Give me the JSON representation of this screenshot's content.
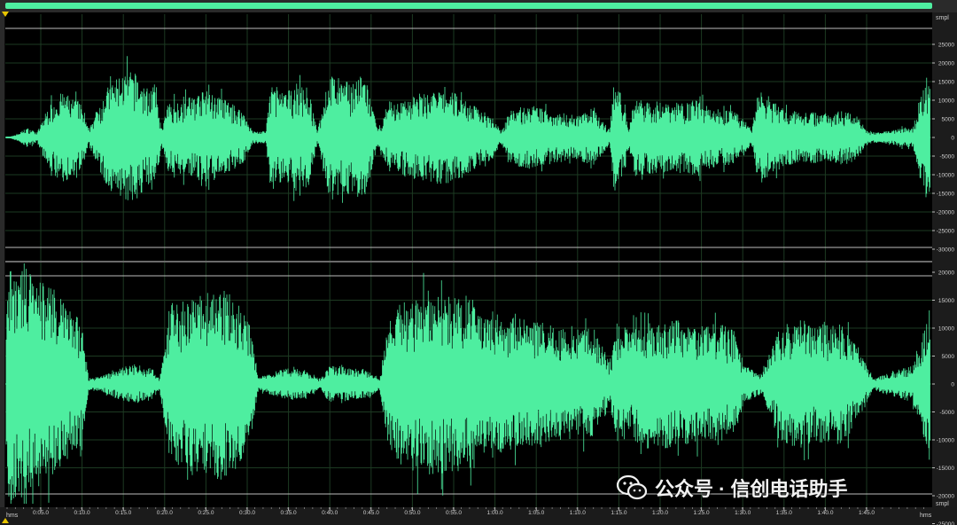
{
  "colors": {
    "waveform": "#4eeea0",
    "background": "#000000",
    "grid": "#1d3a22",
    "range_bar": "#4eeea0",
    "marker": "#e7c400"
  },
  "ruler": {
    "unit_top": "smpl",
    "unit_bottom": "smpl",
    "ch1_ticks": [
      {
        "label": "25000",
        "v": 25000
      },
      {
        "label": "20000",
        "v": 20000
      },
      {
        "label": "15000",
        "v": 15000
      },
      {
        "label": "10000",
        "v": 10000
      },
      {
        "label": "5000",
        "v": 5000
      },
      {
        "label": "0",
        "v": 0
      },
      {
        "label": "-5000",
        "v": -5000
      },
      {
        "label": "-10000",
        "v": -10000
      },
      {
        "label": "-15000",
        "v": -15000
      },
      {
        "label": "-20000",
        "v": -20000
      },
      {
        "label": "-25000",
        "v": -25000
      },
      {
        "label": "-30000",
        "v": -30000
      }
    ],
    "ch2_ticks": [
      {
        "label": "20000",
        "v": 20000
      },
      {
        "label": "15000",
        "v": 15000
      },
      {
        "label": "10000",
        "v": 10000
      },
      {
        "label": "5000",
        "v": 5000
      },
      {
        "label": "0",
        "v": 0
      },
      {
        "label": "-5000",
        "v": -5000
      },
      {
        "label": "-10000",
        "v": -10000
      },
      {
        "label": "-15000",
        "v": -15000
      },
      {
        "label": "-20000",
        "v": -20000
      },
      {
        "label": "-25000",
        "v": -25000
      }
    ]
  },
  "timeline": {
    "unit_left": "hms",
    "unit_right": "hms",
    "labels": [
      "0:05.0",
      "0:10.0",
      "0:15.0",
      "0:20.0",
      "0:25.0",
      "0:30.0",
      "0:35.0",
      "0:40.0",
      "0:45.0",
      "0:50.0",
      "0:55.0",
      "1:00.0",
      "1:05.0",
      "1:10.0",
      "1:15.0",
      "1:20.0",
      "1:25.0",
      "1:30.0",
      "1:35.0",
      "1:40.0",
      "1:45.0"
    ]
  },
  "watermark": {
    "icon": "wechat-icon",
    "text": "公众号 · 信创电话助手"
  }
}
